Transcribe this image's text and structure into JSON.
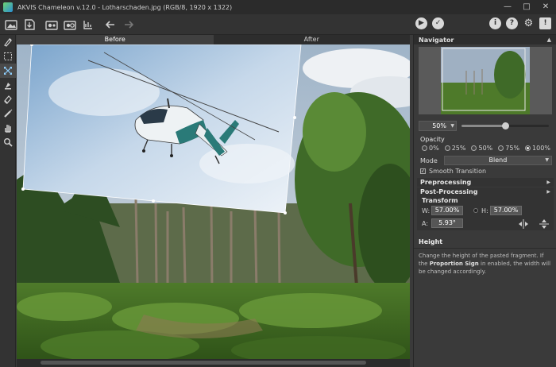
{
  "window": {
    "title": "AKVIS Chameleon v.12.0 - Lotharschaden.jpg (RGB/8, 1920 x 1322)",
    "controls": [
      "minimize-icon",
      "maximize-icon",
      "close-icon"
    ]
  },
  "toolbar": {
    "left_icons": [
      "open-image-icon",
      "save-icon",
      "open-fragment-icon",
      "open-fragment-2-icon",
      "batch-icon",
      "undo-icon",
      "redo-icon"
    ],
    "run_icons": [
      "run-icon",
      "apply-icon"
    ],
    "right_icons": [
      "info-icon",
      "help-icon",
      "settings-icon",
      "notifications-icon"
    ]
  },
  "tools": [
    "selection-brush-icon",
    "rect-selection-icon",
    "transform-icon",
    "stamp-icon",
    "eraser-icon",
    "brush-icon",
    "hand-icon",
    "zoom-icon"
  ],
  "tabs": [
    {
      "label": "Before",
      "active": true
    },
    {
      "label": "After",
      "active": false
    }
  ],
  "navigator": {
    "title": "Navigator",
    "zoom": "50%",
    "zoom_slider": 0.5
  },
  "settings": {
    "opacity_label": "Opacity",
    "opacity_options": [
      "0%",
      "25%",
      "50%",
      "75%",
      "100%"
    ],
    "opacity_selected": "100%",
    "mode_label": "Mode",
    "mode_value": "Blend",
    "smooth_transition": "Smooth Transition",
    "smooth_checked": true,
    "preprocessing": "Preprocessing",
    "postprocessing": "Post-Processing",
    "transform_label": "Transform",
    "w_label": "W:",
    "w_value": "57.00%",
    "h_label": "H:",
    "h_value": "57.00%",
    "a_label": "A:",
    "a_value": "5.93°"
  },
  "help": {
    "title": "Height",
    "text_part1": "Change the height of the pasted fragment. If the ",
    "text_bold": "Proportion Sign",
    "text_part2": " in enabled, the width will be changed accordingly."
  },
  "colors": {
    "panel_bg": "#3a3a3a",
    "titlebar_bg": "#2b2b2b"
  }
}
